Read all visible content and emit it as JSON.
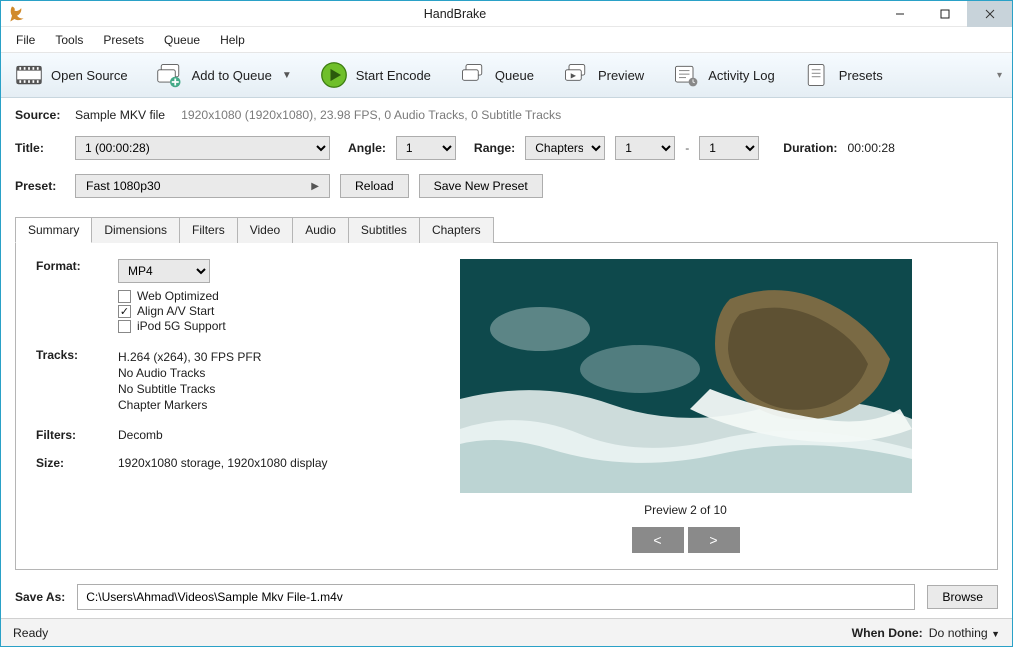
{
  "window": {
    "title": "HandBrake"
  },
  "menubar": [
    "File",
    "Tools",
    "Presets",
    "Queue",
    "Help"
  ],
  "toolbar": {
    "open": {
      "label": "Open Source"
    },
    "addq": {
      "label": "Add to Queue"
    },
    "start": {
      "label": "Start Encode"
    },
    "queue": {
      "label": "Queue"
    },
    "preview": {
      "label": "Preview"
    },
    "log": {
      "label": "Activity Log"
    },
    "presets": {
      "label": "Presets"
    }
  },
  "source": {
    "label": "Source:",
    "name": "Sample MKV file",
    "details": "1920x1080 (1920x1080), 23.98 FPS, 0 Audio Tracks, 0 Subtitle Tracks"
  },
  "title": {
    "label": "Title:",
    "value": "1  (00:00:28)"
  },
  "angle": {
    "label": "Angle:",
    "value": "1"
  },
  "range": {
    "label": "Range:",
    "mode": "Chapters",
    "from": "1",
    "dash": "-",
    "to": "1"
  },
  "duration": {
    "label": "Duration:",
    "value": "00:00:28"
  },
  "preset": {
    "label": "Preset:",
    "value": "Fast 1080p30",
    "reload": "Reload",
    "savenew": "Save New Preset"
  },
  "tabs": [
    "Summary",
    "Dimensions",
    "Filters",
    "Video",
    "Audio",
    "Subtitles",
    "Chapters"
  ],
  "summary": {
    "format": {
      "label": "Format:",
      "value": "MP4"
    },
    "opts": {
      "web": "Web Optimized",
      "align": "Align A/V Start",
      "ipod": "iPod 5G Support",
      "align_checked": true
    },
    "tracks": {
      "label": "Tracks:",
      "lines": [
        "H.264 (x264), 30 FPS PFR",
        "No Audio Tracks",
        "No Subtitle Tracks",
        "Chapter Markers"
      ]
    },
    "filters": {
      "label": "Filters:",
      "value": "Decomb"
    },
    "size": {
      "label": "Size:",
      "value": "1920x1080 storage, 1920x1080 display"
    },
    "preview_caption": "Preview 2 of 10",
    "prev": "<",
    "next": ">"
  },
  "saveas": {
    "label": "Save As:",
    "path": "C:\\Users\\Ahmad\\Videos\\Sample Mkv File-1.m4v",
    "browse": "Browse"
  },
  "status": {
    "ready": "Ready",
    "whendone_label": "When Done:",
    "whendone_value": "Do nothing"
  }
}
